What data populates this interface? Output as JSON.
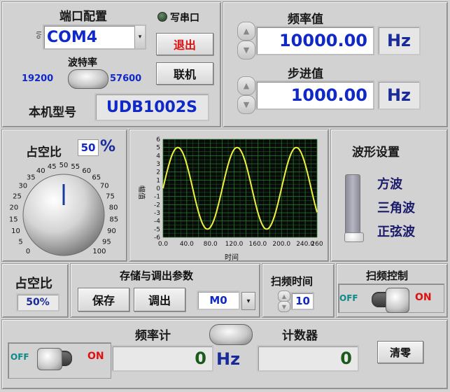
{
  "port": {
    "title": "端口配置",
    "resource_glyph": "I/o",
    "value": "COM4",
    "write_led_label": "写串口",
    "exit_label": "退出",
    "connect_label": "联机",
    "baud_title": "波特率",
    "baud_low": "19200",
    "baud_high": "57600",
    "model_label": "本机型号",
    "model_value": "UDB1002S"
  },
  "freq": {
    "title": "频率值",
    "value": "10000.00",
    "unit": "Hz",
    "step_title": "步进值",
    "step_value": "1000.00",
    "step_unit": "Hz"
  },
  "duty": {
    "title": "占空比",
    "value": "50",
    "unit": "%",
    "dial_value": 50,
    "ticks": [
      "0",
      "5",
      "10",
      "15",
      "20",
      "25",
      "30",
      "35",
      "40",
      "45",
      "50",
      "55",
      "60",
      "65",
      "70",
      "75",
      "80",
      "85",
      "90",
      "95",
      "100"
    ]
  },
  "chart_data": {
    "type": "line",
    "title": "",
    "xlabel": "时间",
    "ylabel": "幅值",
    "xlim": [
      0,
      260
    ],
    "ylim": [
      -6,
      6
    ],
    "x_ticks": [
      "0.0",
      "20.0",
      "40.0",
      "60.0",
      "80.0",
      "100.0",
      "120.0",
      "140.0",
      "160.0",
      "180.0",
      "200.0",
      "220.0",
      "240.0",
      "260"
    ],
    "y_ticks": [
      "6",
      "5",
      "4",
      "3",
      "2",
      "1",
      "0",
      "-1",
      "-2",
      "-3",
      "-4",
      "-5",
      "-6"
    ],
    "series": [
      {
        "amplitude": 5,
        "period": 100,
        "phase": 0,
        "color": "#f0f040"
      }
    ],
    "background": "#0a0a0a",
    "grid": true,
    "grid_color": "#1f7a2a"
  },
  "waveform": {
    "title": "波形设置",
    "options": [
      "方波",
      "三角波",
      "正弦波"
    ],
    "selected": "正弦波"
  },
  "duty2": {
    "title": "占空比",
    "value": "50%"
  },
  "store": {
    "title": "存储与调出参数",
    "save_label": "保存",
    "load_label": "调出",
    "slot_value": "M0"
  },
  "sweep": {
    "time_title": "扫频时间",
    "time_value": "10",
    "ctrl_title": "扫频控制",
    "off_label": "OFF",
    "on_label": "ON"
  },
  "meter": {
    "freq_title": "频率计",
    "off_label": "OFF",
    "on_label": "ON",
    "freq_value": "0",
    "freq_unit": "Hz",
    "counter_title": "计数器",
    "counter_value": "0",
    "clear_label": "清零"
  }
}
